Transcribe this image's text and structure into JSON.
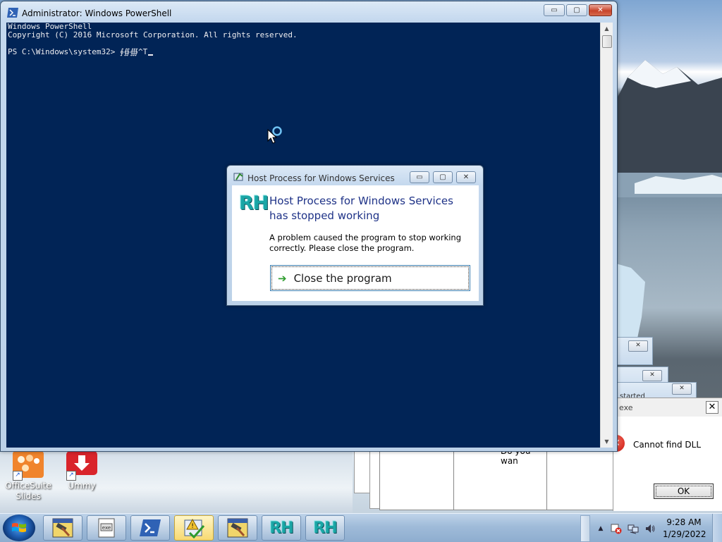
{
  "powershell": {
    "title": "Administrator: Windows PowerShell",
    "lines": [
      "Windows PowerShell",
      "Copyright (C) 2016 Microsoft Corporation. All rights reserved.",
      "",
      "PS C:\\Windows\\system32> ∮∯∰^T"
    ],
    "buttons": {
      "minimize": "▭",
      "maximize": "▢",
      "close": "✕"
    }
  },
  "host_dialog": {
    "title": "Host Process for Windows Services",
    "logo": "RH",
    "heading": "Host Process for Windows Services has stopped working",
    "message": "A problem caused the program to stop working correctly. Please close the program.",
    "close_button": "Close the program",
    "close_arrow": "➔"
  },
  "background_dialogs": {
    "partial_title": "started",
    "partial_text": "Do you wan"
  },
  "dll_dialog": {
    "title": "exe",
    "message": "Cannot find DLL",
    "ok": "OK",
    "close": "✕",
    "error_glyph": "✕"
  },
  "desktop_icons": [
    {
      "label": "OfficeSuite Slides",
      "icon": "officesuite-slides-icon"
    },
    {
      "label": "Ummy",
      "icon": "ummy-icon"
    }
  ],
  "taskbar": {
    "buttons": [
      {
        "name": "hammer-app",
        "glyph": "🔨"
      },
      {
        "name": "installer-app",
        "glyph": "▣"
      },
      {
        "name": "powershell",
        "glyph": ">_"
      },
      {
        "name": "warning-app",
        "glyph": "⚠"
      },
      {
        "name": "hammer-app-2",
        "glyph": "🔨"
      },
      {
        "name": "rh-app-1",
        "glyph": "RH"
      },
      {
        "name": "rh-app-2",
        "glyph": "RH"
      }
    ],
    "active_index": 3,
    "tray": {
      "chevron": "▲",
      "time": "9:28 AM",
      "date": "1/29/2022"
    }
  }
}
